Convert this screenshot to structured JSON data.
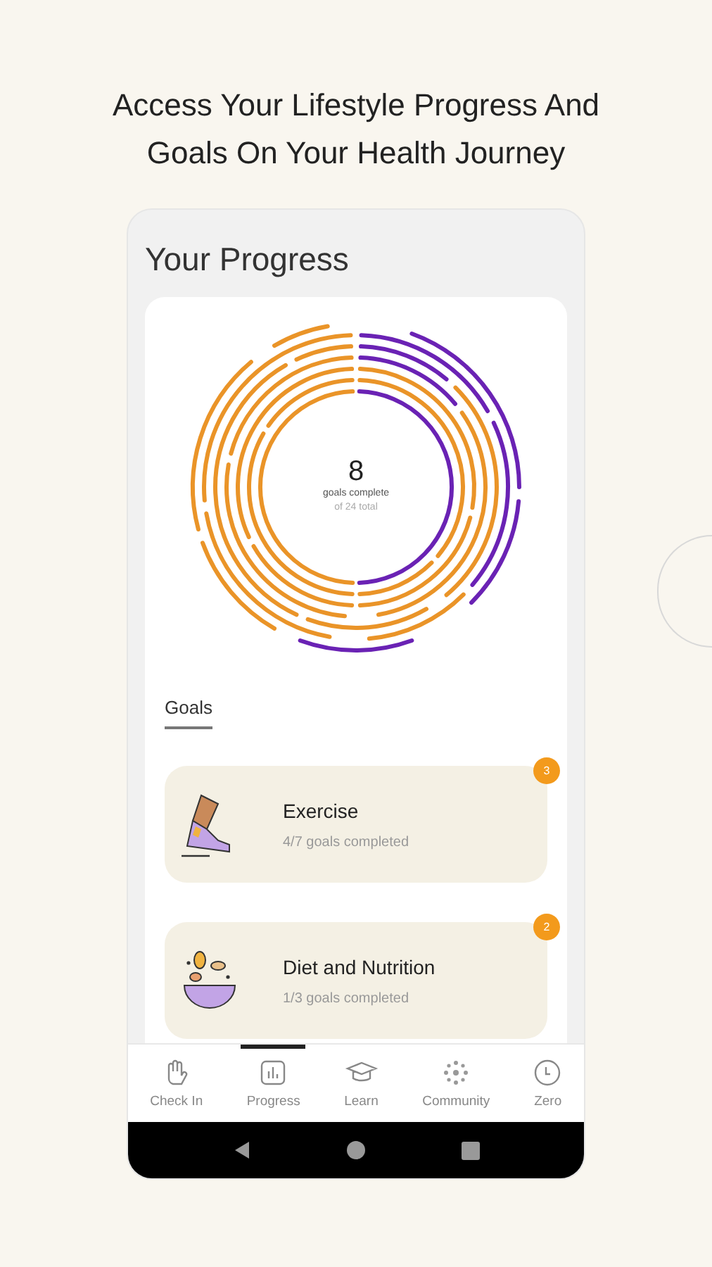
{
  "heading": "Access Your Lifestyle Progress And Goals On Your Health Journey",
  "screen": {
    "title": "Your Progress",
    "summary": {
      "count": "8",
      "label": "goals complete",
      "total": "of 24 total"
    },
    "section_tab": {
      "label": "Goals",
      "selected": true
    },
    "goals": [
      {
        "kind": "exercise",
        "title": "Exercise",
        "progress": "4/7 goals completed",
        "badge": "3"
      },
      {
        "kind": "diet",
        "title": "Diet and Nutrition",
        "progress": "1/3 goals completed",
        "badge": "2"
      }
    ],
    "nav": [
      {
        "kind": "checkin",
        "label": "Check In",
        "selected": false
      },
      {
        "kind": "progress",
        "label": "Progress",
        "selected": true
      },
      {
        "kind": "learn",
        "label": "Learn",
        "selected": false
      },
      {
        "kind": "community",
        "label": "Community",
        "selected": false
      },
      {
        "kind": "zero",
        "label": "Zero",
        "selected": false
      }
    ]
  }
}
